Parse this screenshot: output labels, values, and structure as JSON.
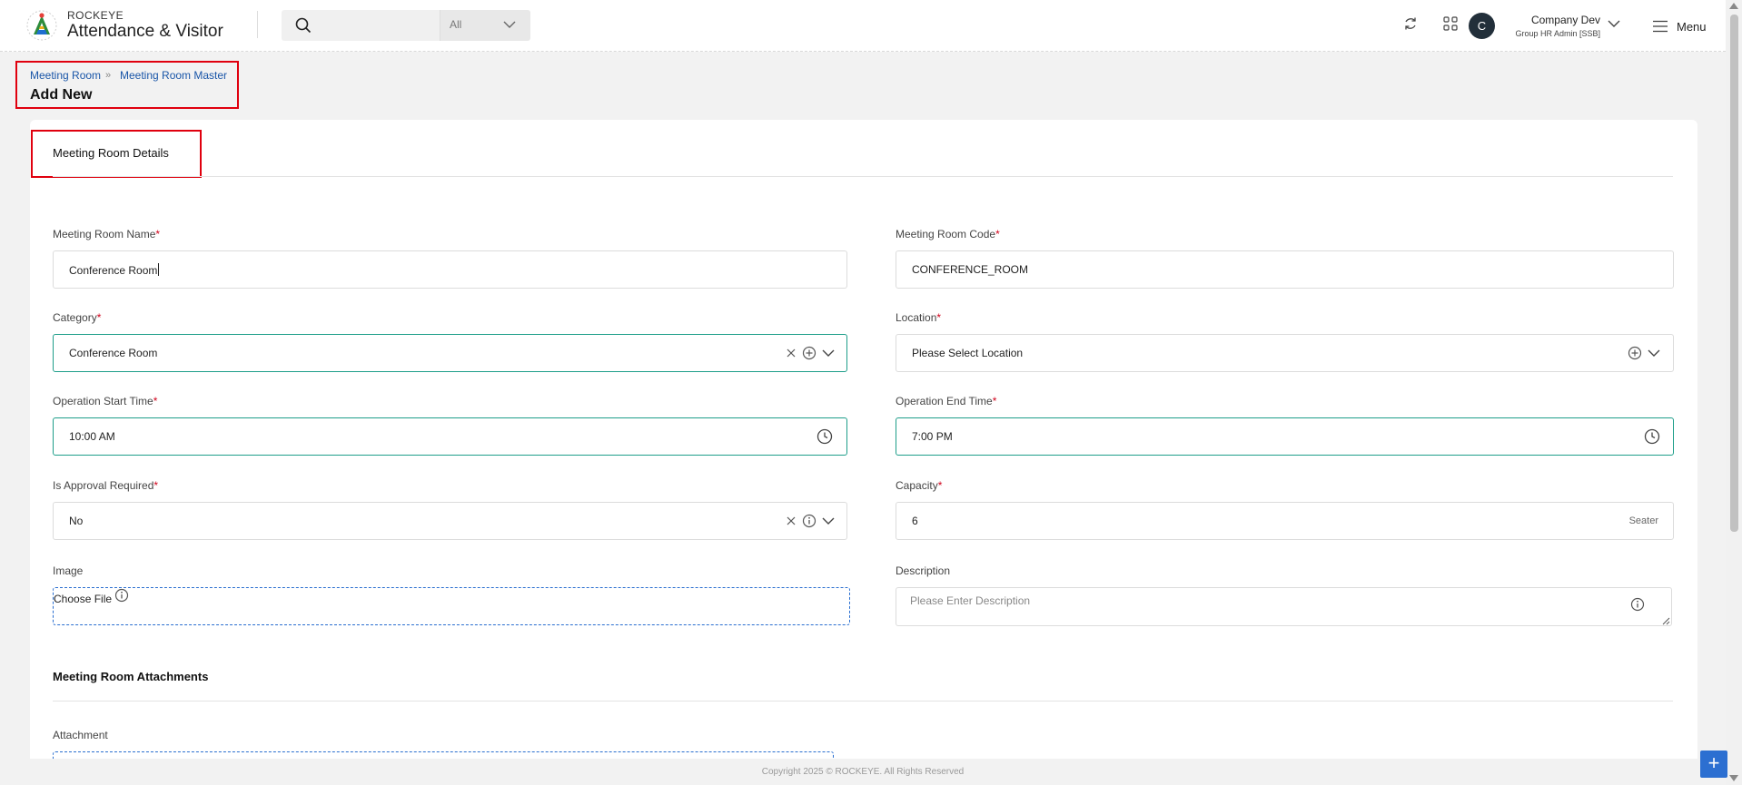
{
  "header": {
    "brand_top": "ROCKEYE",
    "brand_main": "Attendance & Visitor",
    "search_placeholder": "",
    "search_filter": "All",
    "user_initial": "C",
    "user_name": "Company Dev",
    "user_role": "Group HR Admin [SSB]",
    "menu_label": "Menu"
  },
  "breadcrumb": {
    "items": [
      "Meeting Room",
      "Meeting Room Master"
    ],
    "separator": "»"
  },
  "page_title": "Add New",
  "tab": {
    "label": "Meeting Room Details"
  },
  "form": {
    "room_name": {
      "label": "Meeting Room Name",
      "value": "Conference Room"
    },
    "room_code": {
      "label": "Meeting Room Code",
      "value": "CONFERENCE_ROOM"
    },
    "category": {
      "label": "Category",
      "value": "Conference Room"
    },
    "location": {
      "label": "Location",
      "value": "Please Select Location"
    },
    "start_time": {
      "label": "Operation Start Time",
      "value": "10:00 AM"
    },
    "end_time": {
      "label": "Operation End Time",
      "value": "7:00 PM"
    },
    "approval": {
      "label": "Is Approval Required",
      "value": "No"
    },
    "capacity": {
      "label": "Capacity",
      "value": "6",
      "suffix": "Seater"
    },
    "image": {
      "label": "Image",
      "placeholder": "Choose File"
    },
    "description": {
      "label": "Description",
      "placeholder": "Please Enter Description"
    }
  },
  "attachments": {
    "section_title": "Meeting Room Attachments",
    "attachment_label": "Attachment"
  },
  "footer": {
    "copyright": "Copyright 2025 © ROCKEYE. All Rights Reserved"
  },
  "colors": {
    "accent_teal": "#1e9e8a",
    "link_blue": "#1a56a8",
    "highlight_red": "#e0000e",
    "fab_blue": "#2c6fd1"
  }
}
